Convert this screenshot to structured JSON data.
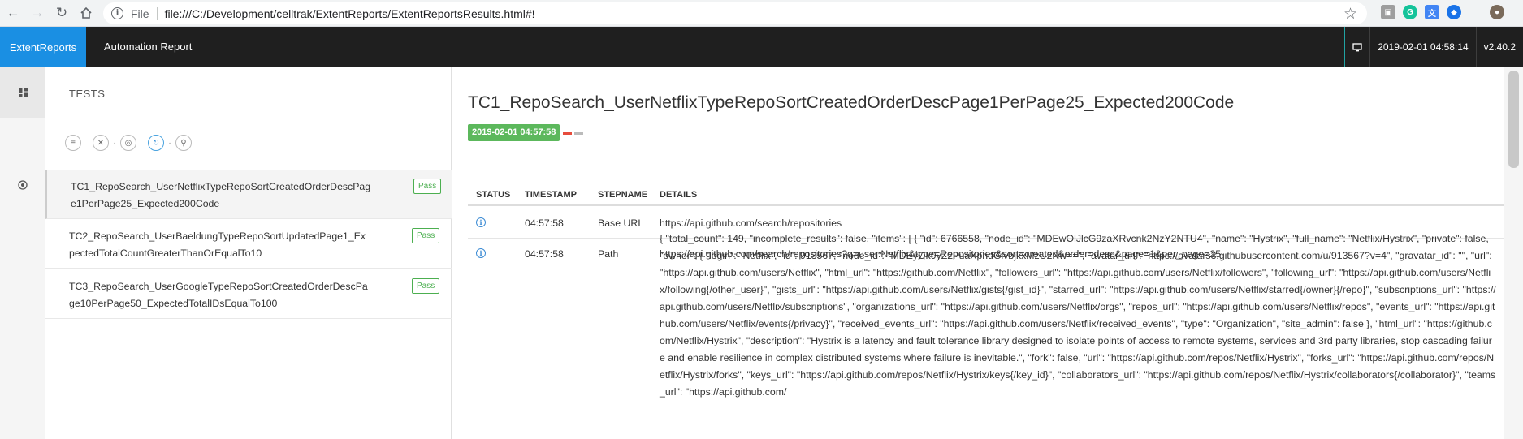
{
  "browser": {
    "scheme": "File",
    "url": "file:///C:/Development/celltrak/ExtentReports/ExtentReportsResults.html#!",
    "icons": [
      "back-icon",
      "forward-icon",
      "reload-icon",
      "home-icon",
      "info-icon",
      "star-icon",
      "camera-icon",
      "grammarly-icon",
      "translate-icon",
      "shield-icon",
      "profile-avatar-icon"
    ]
  },
  "header": {
    "brand": "ExtentReports",
    "title": "Automation Report",
    "timestamp": "2019-02-01 04:58:14",
    "version": "v2.40.2",
    "brand_color": "#1a8fe3"
  },
  "tests_panel": {
    "heading": "TESTS",
    "filters": [
      "list-filter-icon",
      "close-filter-icon",
      "target-filter-icon",
      "refresh-filter-icon",
      "search-filter-icon"
    ],
    "items": [
      {
        "name": "TC1_RepoSearch_UserNetflixTypeRepoSortCreatedOrderDescPage1PerPage25_Expected200Code",
        "status": "Pass"
      },
      {
        "name": "TC2_RepoSearch_UserBaeldungTypeRepoSortUpdatedPage1_ExpectedTotalCountGreaterThanOrEqualTo10",
        "status": "Pass"
      },
      {
        "name": "TC3_RepoSearch_UserGoogleTypeRepoSortCreatedOrderDescPage10PerPage50_ExpectedTotalIDsEqualTo100",
        "status": "Pass"
      }
    ]
  },
  "detail": {
    "title": "TC1_RepoSearch_UserNetflixTypeRepoSortCreatedOrderDescPage1PerPage25_Expected200Code",
    "time_badge": "2019-02-01 04:57:58",
    "columns": {
      "status": "STATUS",
      "timestamp": "TIMESTAMP",
      "stepname": "STEPNAME",
      "details": "DETAILS"
    },
    "logs": [
      {
        "timestamp": "04:57:58",
        "stepname": "Base URI",
        "details": "https://api.github.com/search/repositories"
      },
      {
        "timestamp": "04:57:58",
        "stepname": "Path",
        "details": "https://api.github.com/search/repositories?q=user:Netflix&type=Repositories&sort=created&order=desc&page=1&per_page=25"
      }
    ],
    "json_body": "{ \"total_count\": 149, \"incomplete_results\": false, \"items\": [ { \"id\": 6766558, \"node_id\": \"MDEwOlJlcG9zaXRvcnk2NzY2NTU4\", \"name\": \"Hystrix\", \"full_name\": \"Netflix/Hystrix\", \"private\": false, \"owner\": { \"login\": \"Netflix\", \"id\": 913567, \"node_id\": \"MDEyOk9yZ2FuaXphdGlvbjkxMzU2Nw==\", \"avatar_url\": \"https://avatars3.githubusercontent.com/u/913567?v=4\", \"gravatar_id\": \"\", \"url\": \"https://api.github.com/users/Netflix\", \"html_url\": \"https://github.com/Netflix\", \"followers_url\": \"https://api.github.com/users/Netflix/followers\", \"following_url\": \"https://api.github.com/users/Netflix/following{/other_user}\", \"gists_url\": \"https://api.github.com/users/Netflix/gists{/gist_id}\", \"starred_url\": \"https://api.github.com/users/Netflix/starred{/owner}{/repo}\", \"subscriptions_url\": \"https://api.github.com/users/Netflix/subscriptions\", \"organizations_url\": \"https://api.github.com/users/Netflix/orgs\", \"repos_url\": \"https://api.github.com/users/Netflix/repos\", \"events_url\": \"https://api.github.com/users/Netflix/events{/privacy}\", \"received_events_url\": \"https://api.github.com/users/Netflix/received_events\", \"type\": \"Organization\", \"site_admin\": false }, \"html_url\": \"https://github.com/Netflix/Hystrix\", \"description\": \"Hystrix is a latency and fault tolerance library designed to isolate points of access to remote systems, services and 3rd party libraries, stop cascading failure and enable resilience in complex distributed systems where failure is inevitable.\", \"fork\": false, \"url\": \"https://api.github.com/repos/Netflix/Hystrix\", \"forks_url\": \"https://api.github.com/repos/Netflix/Hystrix/forks\", \"keys_url\": \"https://api.github.com/repos/Netflix/Hystrix/keys{/key_id}\", \"collaborators_url\": \"https://api.github.com/repos/Netflix/Hystrix/collaborators{/collaborator}\", \"teams_url\": \"https://api.github.com/"
  }
}
